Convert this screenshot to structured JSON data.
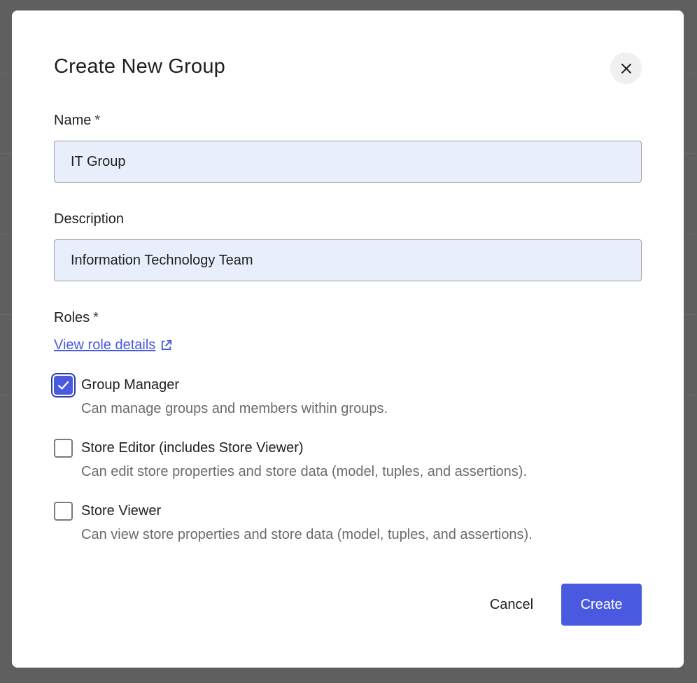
{
  "dialog": {
    "title": "Create New Group",
    "close_icon": "close-icon"
  },
  "form": {
    "name": {
      "label": "Name",
      "required_mark": "*",
      "value": "IT Group"
    },
    "description": {
      "label": "Description",
      "value": "Information Technology Team"
    },
    "roles": {
      "label": "Roles",
      "required_mark": "*",
      "details_link": "View role details",
      "link_icon": "external-link-icon",
      "items": [
        {
          "name": "Group Manager",
          "description": "Can manage groups and members within groups.",
          "checked": true
        },
        {
          "name": "Store Editor (includes Store Viewer)",
          "description": "Can edit store properties and store data (model, tuples, and assertions).",
          "checked": false
        },
        {
          "name": "Store Viewer",
          "description": "Can view store properties and store data (model, tuples, and assertions).",
          "checked": false
        }
      ]
    }
  },
  "actions": {
    "cancel": "Cancel",
    "create": "Create"
  },
  "colors": {
    "accent": "#4a5ae0",
    "input_bg": "#e8eefc",
    "overlay": "#5f5f5f"
  }
}
